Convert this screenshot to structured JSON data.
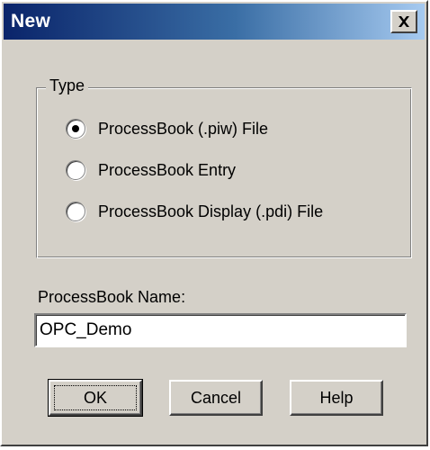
{
  "window": {
    "title": "New",
    "close_icon": "close-x-icon"
  },
  "type_group": {
    "label": "Type",
    "options": [
      {
        "label": "ProcessBook (.piw) File",
        "selected": true
      },
      {
        "label": "ProcessBook Entry",
        "selected": false
      },
      {
        "label": "ProcessBook Display (.pdi) File",
        "selected": false
      }
    ]
  },
  "name_field": {
    "label": "ProcessBook Name:",
    "value": "OPC_Demo"
  },
  "buttons": {
    "ok": "OK",
    "cancel": "Cancel",
    "help": "Help"
  },
  "colors": {
    "face": "#d4d0c8",
    "title_start": "#0a246a",
    "title_end": "#a6caf0"
  }
}
